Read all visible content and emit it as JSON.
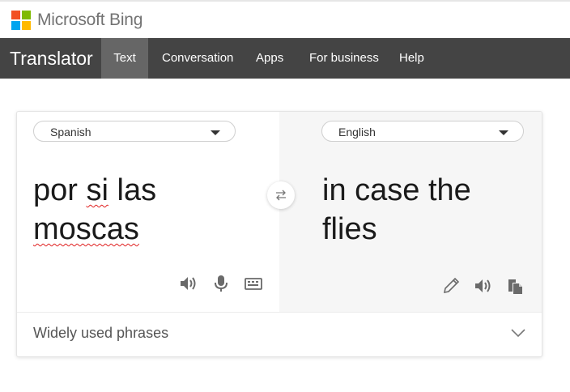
{
  "brand": {
    "name": "Microsoft Bing"
  },
  "nav": {
    "title": "Translator",
    "tabs": [
      {
        "label": "Text",
        "active": true
      },
      {
        "label": "Conversation"
      },
      {
        "label": "Apps"
      },
      {
        "label": "For business"
      },
      {
        "label": "Help"
      }
    ]
  },
  "translator": {
    "source_language": "Spanish",
    "target_language": "English",
    "source_words": [
      "por",
      "si",
      "las",
      "moscas"
    ],
    "target_text": "in case the flies",
    "phrases_label": "Widely used phrases"
  },
  "icons": {
    "swap": "swap-arrows-icon",
    "speaker": "speaker-icon",
    "microphone": "microphone-icon",
    "keyboard": "keyboard-icon",
    "edit": "pencil-icon",
    "copy": "copy-icon",
    "expand": "chevron-down-icon"
  },
  "colors": {
    "nav_bg": "#444444",
    "nav_active": "#666666",
    "spell_underline": "#e02020"
  }
}
